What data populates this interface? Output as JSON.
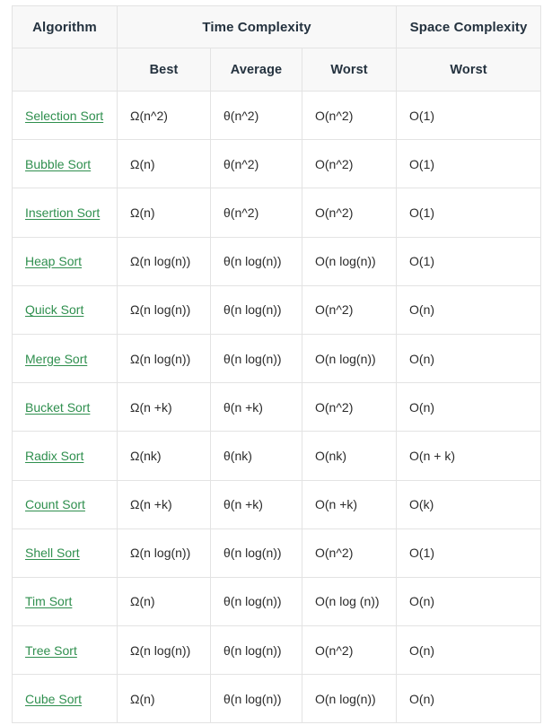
{
  "table": {
    "header": {
      "algorithm": "Algorithm",
      "time_complexity": "Time Complexity",
      "space_complexity": "Space Complexity"
    },
    "subheader": {
      "best": "Best",
      "average": "Average",
      "worst": "Worst",
      "space_worst": "Worst"
    },
    "link_color": "#2f8f4e",
    "header_bg": "#f8f8f8",
    "border_color": "#e3e3e3",
    "rows": [
      {
        "algorithm": "Selection Sort",
        "best": "Ω(n^2)",
        "average": "θ(n^2)",
        "worst": "O(n^2)",
        "space": "O(1)"
      },
      {
        "algorithm": "Bubble Sort",
        "best": "Ω(n)",
        "average": "θ(n^2)",
        "worst": "O(n^2)",
        "space": "O(1)"
      },
      {
        "algorithm": "Insertion Sort",
        "best": "Ω(n)",
        "average": "θ(n^2)",
        "worst": "O(n^2)",
        "space": "O(1)"
      },
      {
        "algorithm": "Heap Sort",
        "best": "Ω(n log(n))",
        "average": "θ(n log(n))",
        "worst": "O(n log(n))",
        "space": "O(1)"
      },
      {
        "algorithm": "Quick Sort",
        "best": "Ω(n log(n))",
        "average": "θ(n log(n))",
        "worst": "O(n^2)",
        "space": "O(n)"
      },
      {
        "algorithm": "Merge Sort",
        "best": "Ω(n log(n))",
        "average": "θ(n log(n))",
        "worst": "O(n log(n))",
        "space": "O(n)"
      },
      {
        "algorithm": "Bucket Sort",
        "best": "Ω(n +k)",
        "average": "θ(n +k)",
        "worst": "O(n^2)",
        "space": "O(n)"
      },
      {
        "algorithm": "Radix Sort",
        "best": "Ω(nk)",
        "average": "θ(nk)",
        "worst": "O(nk)",
        "space": "O(n + k)"
      },
      {
        "algorithm": "Count Sort",
        "best": "Ω(n +k)",
        "average": "θ(n +k)",
        "worst": "O(n +k)",
        "space": "O(k)"
      },
      {
        "algorithm": "Shell Sort",
        "best": "Ω(n log(n))",
        "average": "θ(n log(n))",
        "worst": "O(n^2)",
        "space": "O(1)"
      },
      {
        "algorithm": "Tim Sort",
        "best": "Ω(n)",
        "average": "θ(n log(n))",
        "worst": "O(n log (n))",
        "space": "O(n)"
      },
      {
        "algorithm": "Tree Sort",
        "best": "Ω(n log(n))",
        "average": "θ(n log(n))",
        "worst": "O(n^2)",
        "space": "O(n)"
      },
      {
        "algorithm": "Cube Sort",
        "best": "Ω(n)",
        "average": "θ(n log(n))",
        "worst": "O(n log(n))",
        "space": "O(n)"
      }
    ]
  }
}
